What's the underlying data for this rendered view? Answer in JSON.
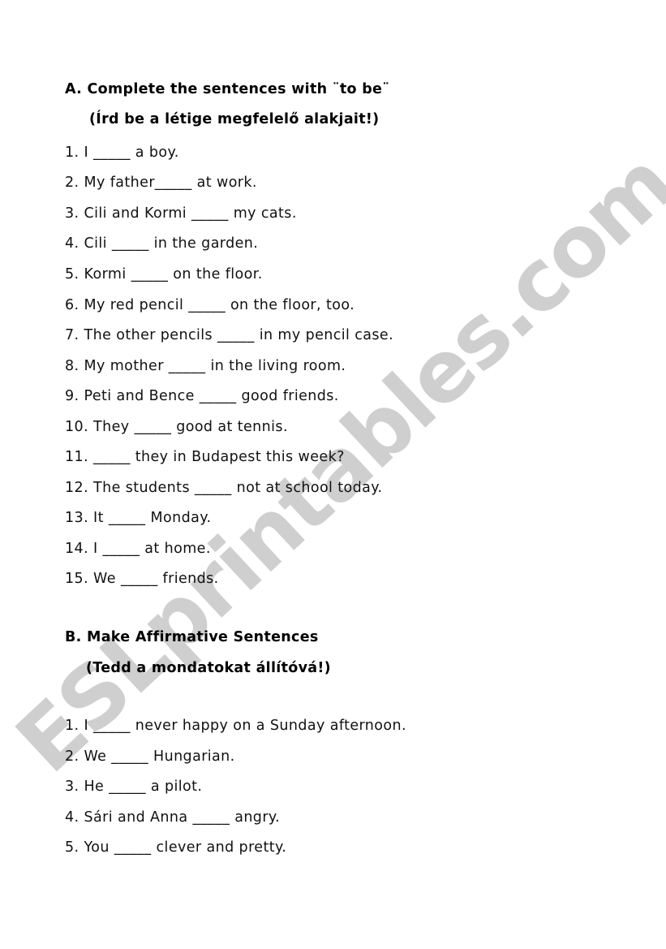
{
  "watermark": "ESLprintables.com",
  "section_a": {
    "title": "A. Complete the sentences with ¨to be¨",
    "subtitle": "(Írd be a létige megfelelő alakjait!)",
    "items": [
      {
        "num": "1.",
        "text": "I _____ a boy."
      },
      {
        "num": "2.",
        "text": "My father_____ at work."
      },
      {
        "num": "3.",
        "text": "Cili and Kormi _____ my cats."
      },
      {
        "num": "4.",
        "text": "Cili _____ in the garden."
      },
      {
        "num": "5.",
        "text": "Kormi _____ on the floor."
      },
      {
        "num": "6.",
        "text": "My red pencil _____ on the floor, too."
      },
      {
        "num": "7.",
        "text": "The other pencils _____ in my pencil case."
      },
      {
        "num": "8.",
        "text": "My mother _____ in the living room."
      },
      {
        "num": "9.",
        "text": "Peti and Bence _____ good friends."
      },
      {
        "num": "10.",
        "text": "They _____ good at tennis."
      },
      {
        "num": "11.",
        "text": "_____ they in Budapest this week?"
      },
      {
        "num": "12.",
        "text": "The students _____ not at school today."
      },
      {
        "num": "13.",
        "text": "It _____ Monday."
      },
      {
        "num": "14.",
        "text": "I _____ at home."
      },
      {
        "num": "15.",
        "text": "We _____ friends."
      }
    ]
  },
  "section_b": {
    "title": "B. Make Affirmative Sentences",
    "subtitle": "(Tedd a mondatokat állítóvá!)",
    "items": [
      {
        "num": "1.",
        "text": "I _____ never happy on a Sunday afternoon."
      },
      {
        "num": "2.",
        "text": "We _____ Hungarian."
      },
      {
        "num": "3.",
        "text": "He _____ a pilot."
      },
      {
        "num": "4.",
        "text": "Sári and Anna _____ angry."
      },
      {
        "num": "5.",
        "text": "You _____ clever and pretty."
      }
    ]
  }
}
